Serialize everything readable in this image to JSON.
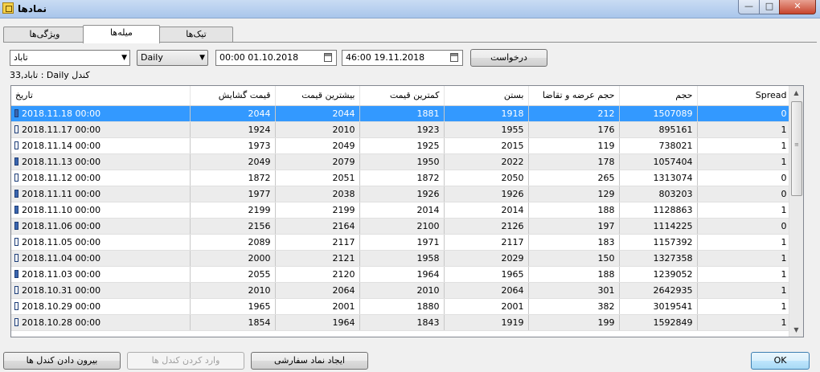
{
  "window": {
    "title": "نمادها",
    "min": "—",
    "max": "□",
    "close": "✕"
  },
  "tabs": [
    {
      "label": "ویژگی‌ها"
    },
    {
      "label": "میله‌ها"
    },
    {
      "label": "تیک‌ها"
    }
  ],
  "controls": {
    "symbol": "تاباد",
    "timeframe": "Daily",
    "date_from": "00:00 01.10.2018",
    "date_to": "46:00 19.11.2018",
    "request_label": "درخواست"
  },
  "info_text": "تاباد,33 : Daily کندل",
  "table": {
    "headers": [
      "تاریخ",
      "قیمت گشایش",
      "بیشترین قیمت",
      "کمترین قیمت",
      "بستن",
      "حجم عرضه و تقاضا",
      "حجم",
      "Spread"
    ],
    "rows": [
      {
        "date": "2018.11.18 00:00",
        "open": "2044",
        "high": "2044",
        "low": "1881",
        "close": "1918",
        "tickvol": "212",
        "vol": "1507089",
        "spread": "0",
        "bear": true
      },
      {
        "date": "2018.11.17 00:00",
        "open": "1924",
        "high": "2010",
        "low": "1923",
        "close": "1955",
        "tickvol": "176",
        "vol": "895161",
        "spread": "1",
        "bear": false
      },
      {
        "date": "2018.11.14 00:00",
        "open": "1973",
        "high": "2049",
        "low": "1925",
        "close": "2015",
        "tickvol": "119",
        "vol": "738021",
        "spread": "1",
        "bear": false
      },
      {
        "date": "2018.11.13 00:00",
        "open": "2049",
        "high": "2079",
        "low": "1950",
        "close": "2022",
        "tickvol": "178",
        "vol": "1057404",
        "spread": "1",
        "bear": true
      },
      {
        "date": "2018.11.12 00:00",
        "open": "1872",
        "high": "2051",
        "low": "1872",
        "close": "2050",
        "tickvol": "265",
        "vol": "1313074",
        "spread": "0",
        "bear": false
      },
      {
        "date": "2018.11.11 00:00",
        "open": "1977",
        "high": "2038",
        "low": "1926",
        "close": "1926",
        "tickvol": "129",
        "vol": "803203",
        "spread": "0",
        "bear": true
      },
      {
        "date": "2018.11.10 00:00",
        "open": "2199",
        "high": "2199",
        "low": "2014",
        "close": "2014",
        "tickvol": "188",
        "vol": "1128863",
        "spread": "1",
        "bear": true
      },
      {
        "date": "2018.11.06 00:00",
        "open": "2156",
        "high": "2164",
        "low": "2100",
        "close": "2126",
        "tickvol": "197",
        "vol": "1114225",
        "spread": "0",
        "bear": true
      },
      {
        "date": "2018.11.05 00:00",
        "open": "2089",
        "high": "2117",
        "low": "1971",
        "close": "2117",
        "tickvol": "183",
        "vol": "1157392",
        "spread": "1",
        "bear": false
      },
      {
        "date": "2018.11.04 00:00",
        "open": "2000",
        "high": "2121",
        "low": "1958",
        "close": "2029",
        "tickvol": "150",
        "vol": "1327358",
        "spread": "1",
        "bear": false
      },
      {
        "date": "2018.11.03 00:00",
        "open": "2055",
        "high": "2120",
        "low": "1964",
        "close": "1965",
        "tickvol": "188",
        "vol": "1239052",
        "spread": "1",
        "bear": true
      },
      {
        "date": "2018.10.31 00:00",
        "open": "2010",
        "high": "2064",
        "low": "2010",
        "close": "2064",
        "tickvol": "301",
        "vol": "2642935",
        "spread": "1",
        "bear": false
      },
      {
        "date": "2018.10.29 00:00",
        "open": "1965",
        "high": "2001",
        "low": "1880",
        "close": "2001",
        "tickvol": "382",
        "vol": "3019541",
        "spread": "1",
        "bear": false
      },
      {
        "date": "2018.10.28 00:00",
        "open": "1854",
        "high": "1964",
        "low": "1843",
        "close": "1919",
        "tickvol": "199",
        "vol": "1592849",
        "spread": "1",
        "bear": false
      }
    ]
  },
  "buttons": {
    "export": "بیرون دادن کندل ها",
    "import": "وارد کردن کندل ها",
    "create_custom": "ایجاد نماد سفارشی",
    "ok": "OK"
  },
  "scrollbar": {
    "up": "▲",
    "down": "▼",
    "grip": "≡"
  }
}
